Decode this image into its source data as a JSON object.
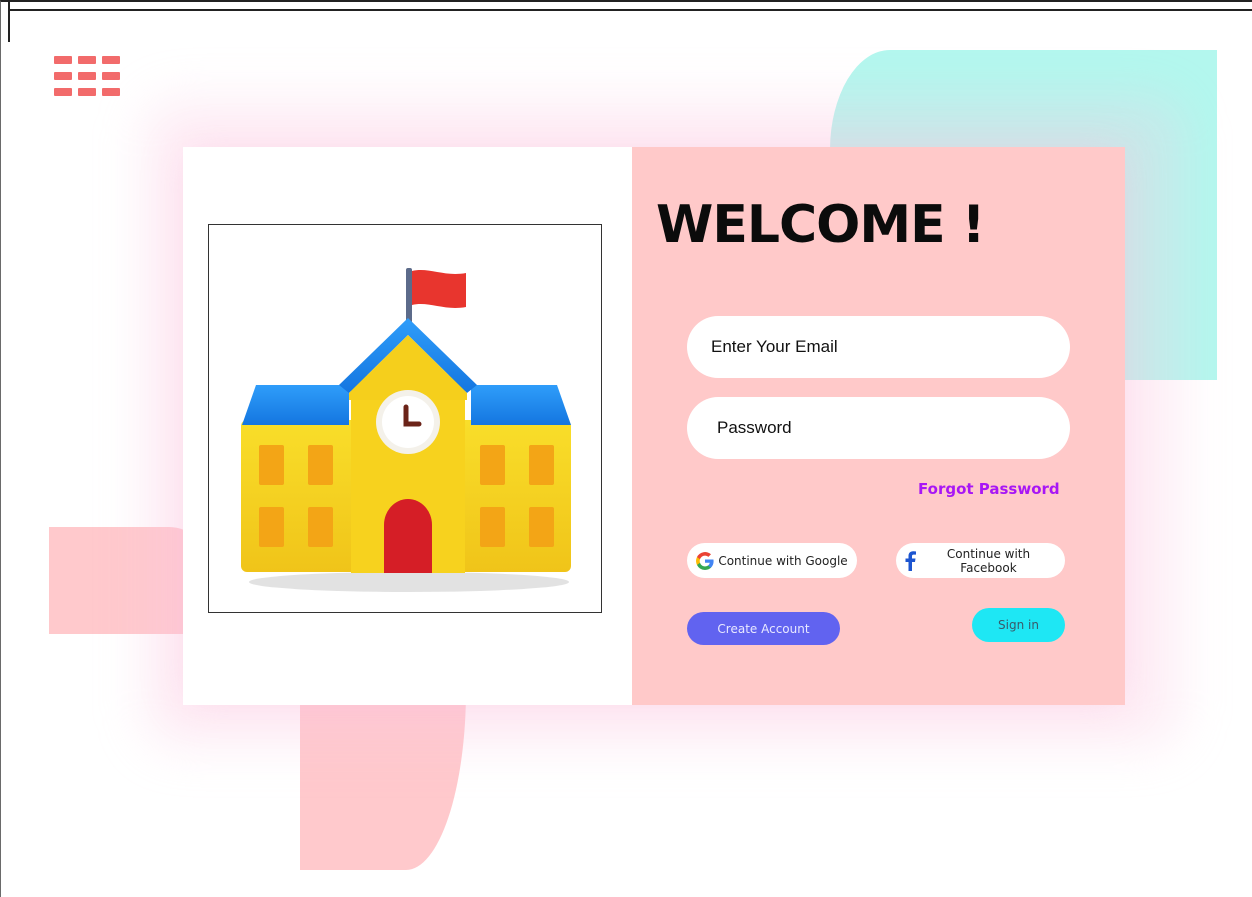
{
  "menu": {
    "icon": "grid-menu-icon"
  },
  "illustration": {
    "icon": "school-building-icon"
  },
  "login": {
    "title": "WELCOME !",
    "email_placeholder": "Enter Your Email",
    "password_placeholder": "Password",
    "forgot_label": "Forgot Password",
    "google_label": "Continue with Google",
    "facebook_label": "Continue with Facebook",
    "create_label": "Create Account",
    "signin_label": "Sign in"
  },
  "colors": {
    "panel": "#ffc9c9",
    "accent_purple": "#a816f5",
    "create_button": "#6163f0",
    "signin_button": "#1ee7f4",
    "teal_blob": "#b3f7ee",
    "pink_blob": "#ffc9cc"
  }
}
